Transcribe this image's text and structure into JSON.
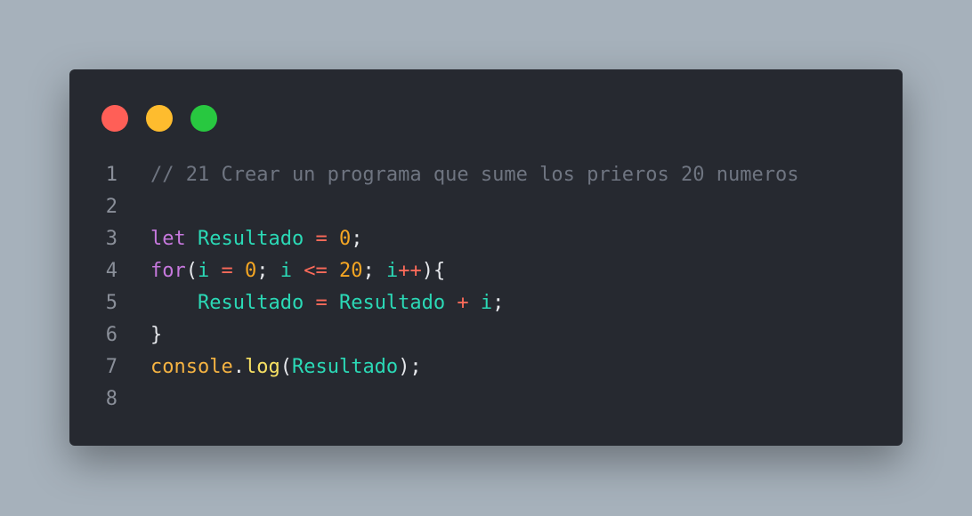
{
  "window": {
    "traffic_lights": [
      {
        "name": "close",
        "color": "#ff5f57"
      },
      {
        "name": "minimize",
        "color": "#febc2e"
      },
      {
        "name": "maximize",
        "color": "#28c840"
      }
    ]
  },
  "code": {
    "lines": [
      {
        "n": "1",
        "tokens": [
          {
            "t": "// 21 Crear un programa que sume los prieros 20 numeros",
            "k": "comment"
          }
        ]
      },
      {
        "n": "2",
        "tokens": []
      },
      {
        "n": "3",
        "tokens": [
          {
            "t": "let",
            "k": "kw"
          },
          {
            "t": " ",
            "k": "punc"
          },
          {
            "t": "Resultado",
            "k": "var"
          },
          {
            "t": " ",
            "k": "punc"
          },
          {
            "t": "=",
            "k": "op"
          },
          {
            "t": " ",
            "k": "punc"
          },
          {
            "t": "0",
            "k": "num"
          },
          {
            "t": ";",
            "k": "punc"
          }
        ]
      },
      {
        "n": "4",
        "tokens": [
          {
            "t": "for",
            "k": "kw"
          },
          {
            "t": "(",
            "k": "punc"
          },
          {
            "t": "i",
            "k": "var"
          },
          {
            "t": " ",
            "k": "punc"
          },
          {
            "t": "=",
            "k": "op"
          },
          {
            "t": " ",
            "k": "punc"
          },
          {
            "t": "0",
            "k": "num"
          },
          {
            "t": "; ",
            "k": "punc"
          },
          {
            "t": "i",
            "k": "var"
          },
          {
            "t": " ",
            "k": "punc"
          },
          {
            "t": "<=",
            "k": "op"
          },
          {
            "t": " ",
            "k": "punc"
          },
          {
            "t": "20",
            "k": "num"
          },
          {
            "t": "; ",
            "k": "punc"
          },
          {
            "t": "i",
            "k": "var"
          },
          {
            "t": "++",
            "k": "op"
          },
          {
            "t": "){",
            "k": "punc"
          }
        ]
      },
      {
        "n": "5",
        "tokens": [
          {
            "t": "    ",
            "k": "punc"
          },
          {
            "t": "Resultado",
            "k": "var"
          },
          {
            "t": " ",
            "k": "punc"
          },
          {
            "t": "=",
            "k": "op"
          },
          {
            "t": " ",
            "k": "punc"
          },
          {
            "t": "Resultado",
            "k": "var"
          },
          {
            "t": " ",
            "k": "punc"
          },
          {
            "t": "+",
            "k": "op"
          },
          {
            "t": " ",
            "k": "punc"
          },
          {
            "t": "i",
            "k": "var"
          },
          {
            "t": ";",
            "k": "punc"
          }
        ]
      },
      {
        "n": "6",
        "tokens": [
          {
            "t": "}",
            "k": "punc"
          }
        ]
      },
      {
        "n": "7",
        "tokens": [
          {
            "t": "console",
            "k": "obj"
          },
          {
            "t": ".",
            "k": "punc"
          },
          {
            "t": "log",
            "k": "fn"
          },
          {
            "t": "(",
            "k": "punc"
          },
          {
            "t": "Resultado",
            "k": "var"
          },
          {
            "t": ");",
            "k": "punc"
          }
        ]
      },
      {
        "n": "8",
        "tokens": []
      }
    ]
  }
}
